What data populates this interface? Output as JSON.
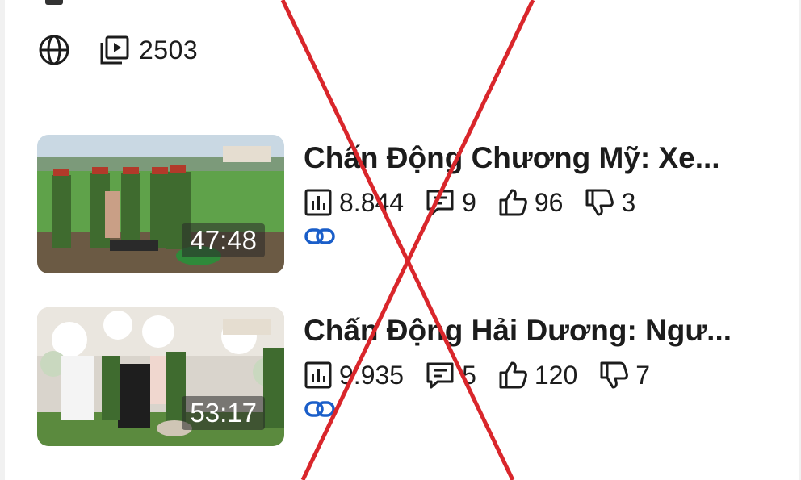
{
  "channel": {
    "video_count": "2503"
  },
  "videos": [
    {
      "title": "Chấn Động Chương Mỹ: Xe...",
      "duration": "47:48",
      "views": "8.844",
      "comments": "9",
      "likes": "96",
      "dislikes": "3"
    },
    {
      "title": "Chấn Động Hải Dương: Ngư...",
      "duration": "53:17",
      "views": "9.935",
      "comments": "5",
      "likes": "120",
      "dislikes": "7"
    }
  ],
  "colors": {
    "cross": "#d9262b",
    "link": "#1a5ec9",
    "text": "#1c1c1c"
  },
  "icons": [
    "globe-icon",
    "playlist-icon",
    "bar-chart-icon",
    "comment-icon",
    "thumbs-up-icon",
    "thumbs-down-icon",
    "link-icon"
  ]
}
